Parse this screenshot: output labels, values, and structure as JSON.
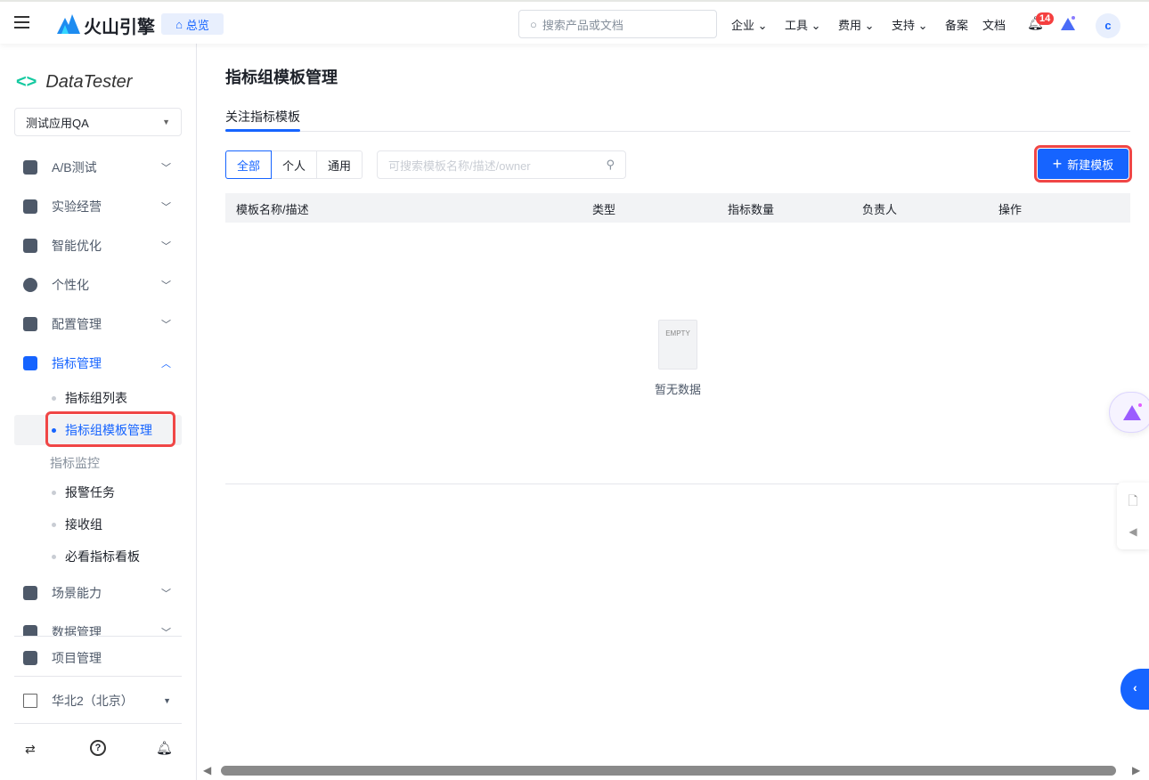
{
  "topbar": {
    "brand": "火山引擎",
    "home": "总览",
    "search_placeholder": "搜索产品或文档",
    "nav": [
      "企业",
      "工具",
      "费用",
      "支持"
    ],
    "links": [
      "备案",
      "文档"
    ],
    "notif_count": "14",
    "avatar": "c"
  },
  "sidebar": {
    "product": "DataTester",
    "app": "测试应用QA",
    "menus": [
      {
        "label": "A/B测试",
        "icon": "flask-icon"
      },
      {
        "label": "实验经营",
        "icon": "tag-icon"
      },
      {
        "label": "智能优化",
        "icon": "branch-icon"
      },
      {
        "label": "个性化",
        "icon": "target-icon"
      },
      {
        "label": "配置管理",
        "icon": "server-icon"
      },
      {
        "label": "指标管理",
        "icon": "bar-chart-icon"
      }
    ],
    "sub": [
      "指标组列表",
      "指标组模板管理"
    ],
    "group": "指标监控",
    "sub2": [
      "报警任务",
      "接收组",
      "必看指标看板"
    ],
    "menus2": [
      {
        "label": "场景能力",
        "icon": "puzzle-icon"
      },
      {
        "label": "数据管理",
        "icon": "database-icon"
      }
    ],
    "project": "项目管理",
    "region": "华北2（北京）"
  },
  "main": {
    "title": "指标组模板管理",
    "tab": "关注指标模板",
    "filters": [
      "全部",
      "个人",
      "通用"
    ],
    "search_placeholder": "可搜索模板名称/描述/owner",
    "new_button": "新建模板",
    "columns": [
      "模板名称/描述",
      "类型",
      "指标数量",
      "负责人",
      "操作"
    ],
    "empty": "暂无数据",
    "empty_img_text": "EMPTY"
  },
  "colors": {
    "accent": "#1664ff",
    "highlight": "#f04646"
  }
}
